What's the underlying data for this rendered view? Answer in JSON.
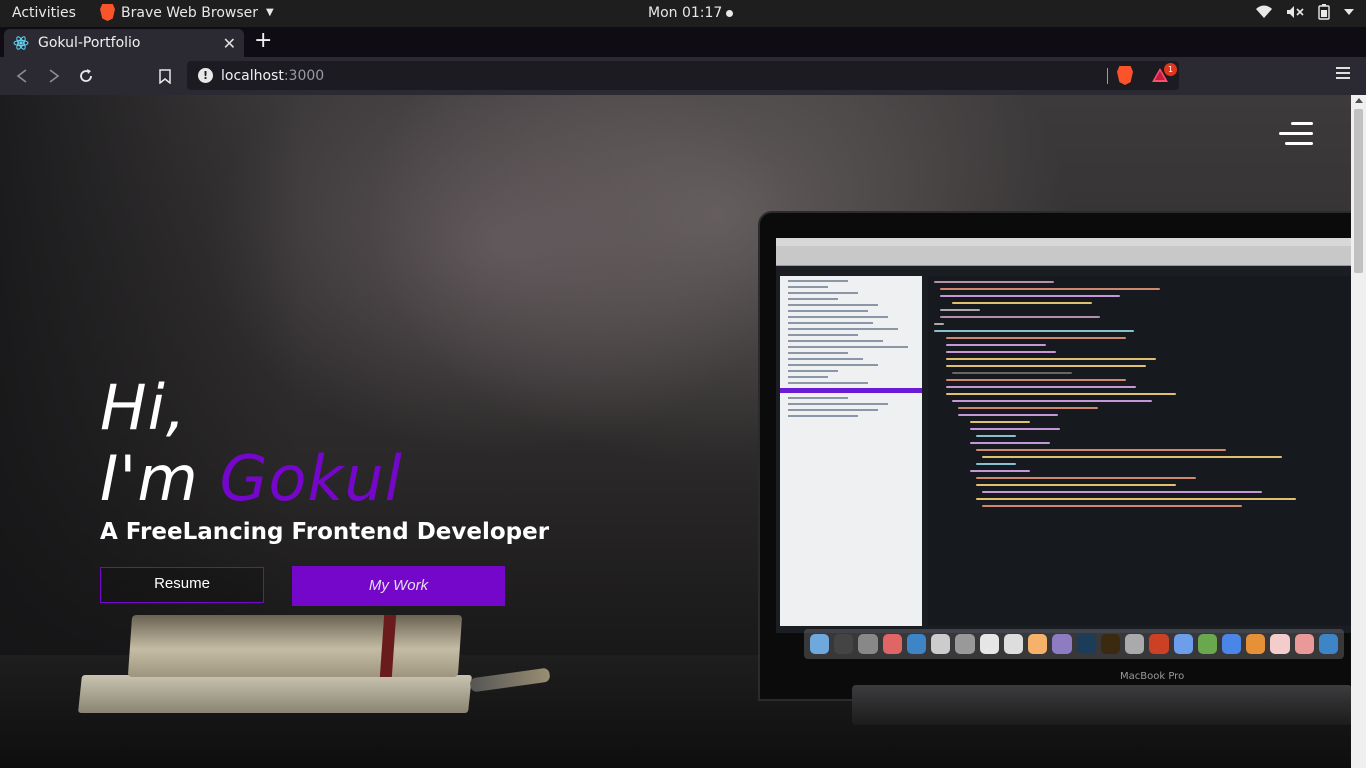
{
  "system_bar": {
    "activities": "Activities",
    "app_name": "Brave Web Browser",
    "clock": "Mon 01:17"
  },
  "browser": {
    "tab_title": "Gokul-Portfolio",
    "url_host": "localhost",
    "url_port": ":3000",
    "rewards_badge": "1",
    "accent_color": "#fb542b"
  },
  "page": {
    "greeting": "Hi,",
    "name_prefix": "I'm ",
    "name": "Gokul",
    "role": "A FreeLancing Frontend Developer",
    "resume_label": "Resume",
    "work_label": "My Work",
    "laptop_label": "MacBook Pro",
    "brand_color": "#7407c9"
  },
  "icons": [
    "brave-lion-icon",
    "wifi-icon",
    "volume-muted-icon",
    "battery-icon",
    "react-icon",
    "close-icon",
    "plus-icon",
    "back-icon",
    "forward-icon",
    "reload-icon",
    "bookmark-icon",
    "info-icon",
    "brave-shield-icon",
    "brave-rewards-icon",
    "hamburger-menu-icon"
  ]
}
